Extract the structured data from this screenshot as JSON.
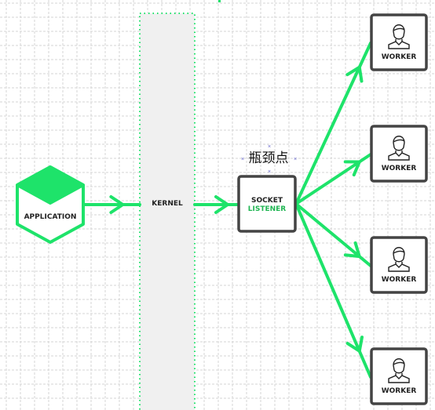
{
  "colors": {
    "accent": "#1ee36a",
    "dark": "#333333",
    "grid": "#d4d4d4",
    "kernel_fill": "#f0f0f0"
  },
  "nodes": {
    "application": {
      "label": "APPLICATION"
    },
    "kernel": {
      "label": "KERNEL"
    },
    "socket": {
      "line1": "SOCKET",
      "line2": "LISTENER"
    },
    "workers": [
      {
        "label": "WORKER"
      },
      {
        "label": "WORKER"
      },
      {
        "label": "WORKER"
      },
      {
        "label": "WORKER"
      }
    ]
  },
  "annotation": {
    "label": "瓶颈点"
  },
  "icons": {
    "worker": "person-icon"
  }
}
